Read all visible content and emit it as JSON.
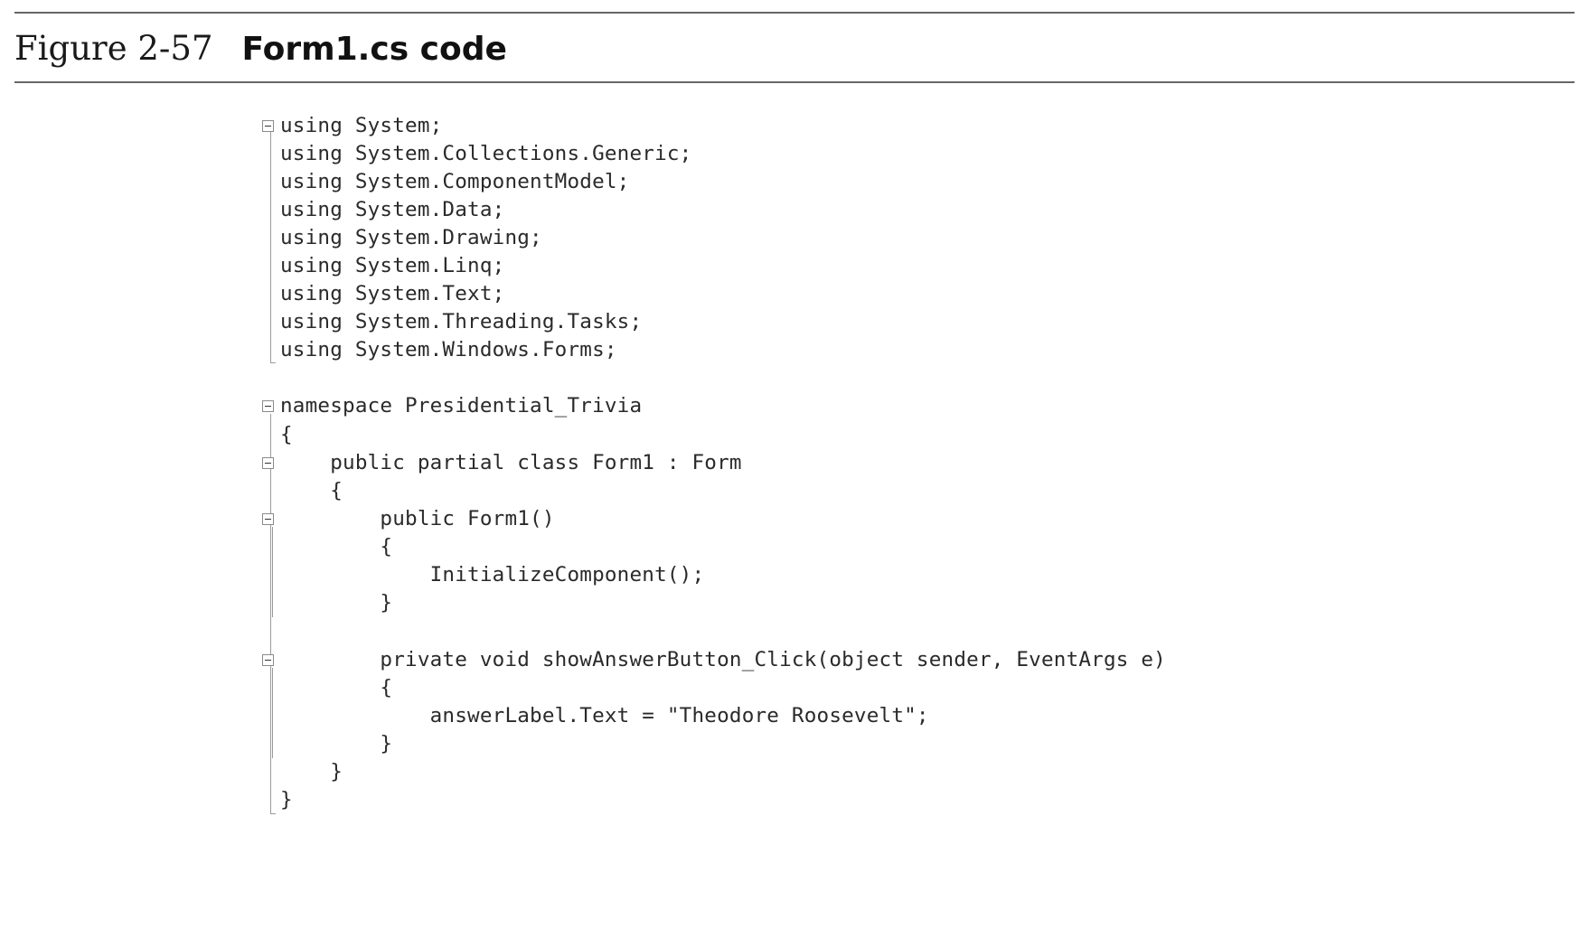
{
  "figure": {
    "number": "Figure 2-57",
    "title": "Form1.cs code"
  },
  "code": {
    "lines": [
      "using System;",
      "using System.Collections.Generic;",
      "using System.ComponentModel;",
      "using System.Data;",
      "using System.Drawing;",
      "using System.Linq;",
      "using System.Text;",
      "using System.Threading.Tasks;",
      "using System.Windows.Forms;",
      "",
      "namespace Presidential_Trivia",
      "{",
      "    public partial class Form1 : Form",
      "    {",
      "        public Form1()",
      "        {",
      "            InitializeComponent();",
      "        }",
      "",
      "        private void showAnswerButton_Click(object sender, EventArgs e)",
      "        {",
      "            answerLabel.Text = \"Theodore Roosevelt\";",
      "        }",
      "    }",
      "}"
    ],
    "fold_icon": "collapse-minus-icon"
  }
}
